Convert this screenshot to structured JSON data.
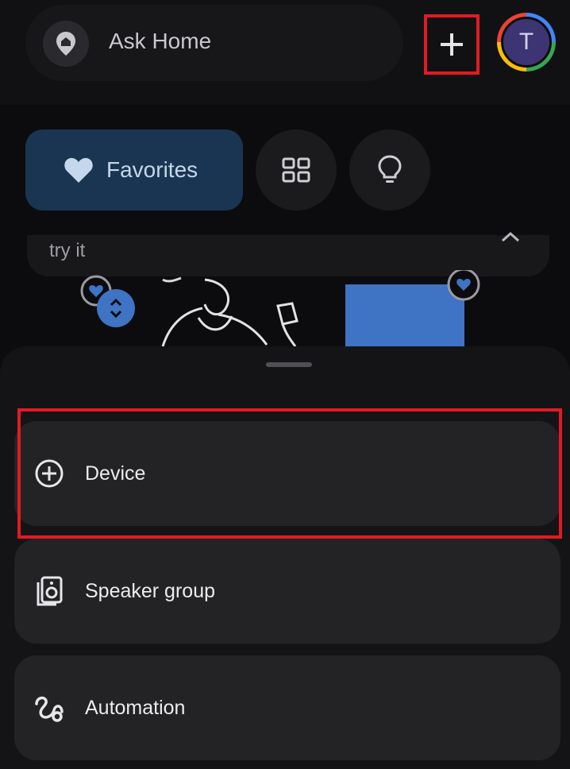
{
  "header": {
    "search_placeholder": "Ask Home",
    "add_icon": "plus-icon",
    "avatar_letter": "T"
  },
  "chips": {
    "favorites_label": "Favorites",
    "favorites_icon": "heart-icon",
    "devices_icon": "grid-icon",
    "suggestions_icon": "lightbulb-icon"
  },
  "tryit": {
    "label": "try it"
  },
  "sheet": {
    "options": [
      {
        "label": "Device",
        "icon": "add-circle-icon"
      },
      {
        "label": "Speaker group",
        "icon": "speaker-icon"
      },
      {
        "label": "Automation",
        "icon": "automation-icon"
      }
    ]
  },
  "colors": {
    "highlight": "#e01b24",
    "favorites_chip": "#1a3551",
    "accent_blue": "#3f73c4"
  }
}
